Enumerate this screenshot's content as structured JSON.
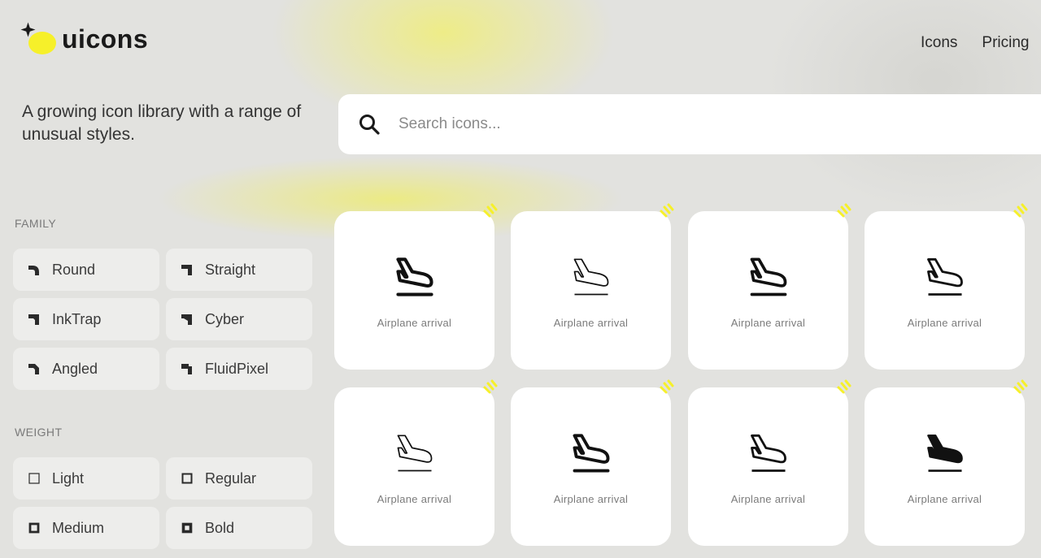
{
  "brand": {
    "name": "uicons",
    "accent": "#f6f02a"
  },
  "nav": {
    "items": [
      "Icons",
      "Pricing"
    ]
  },
  "tagline": "A growing icon library with a range of unusual styles.",
  "search": {
    "placeholder": "Search icons...",
    "value": ""
  },
  "family": {
    "label": "FAMILY",
    "items": [
      {
        "label": "Round",
        "icon": "corner-round-icon"
      },
      {
        "label": "Straight",
        "icon": "corner-straight-icon"
      },
      {
        "label": "InkTrap",
        "icon": "corner-inktrap-icon"
      },
      {
        "label": "Cyber",
        "icon": "corner-cyber-icon"
      },
      {
        "label": "Angled",
        "icon": "corner-angled-icon"
      },
      {
        "label": "FluidPixel",
        "icon": "corner-fluidpixel-icon"
      }
    ]
  },
  "weight": {
    "label": "WEIGHT",
    "items": [
      {
        "label": "Light",
        "icon": "square-light-icon"
      },
      {
        "label": "Regular",
        "icon": "square-regular-icon"
      },
      {
        "label": "Medium",
        "icon": "square-medium-icon"
      },
      {
        "label": "Bold",
        "icon": "square-bold-icon"
      }
    ]
  },
  "results": [
    {
      "label": "Airplane arrival",
      "icon": "airplane-arrival-icon"
    },
    {
      "label": "Airplane arrival",
      "icon": "airplane-arrival-icon"
    },
    {
      "label": "Airplane arrival",
      "icon": "airplane-arrival-icon"
    },
    {
      "label": "Airplane arrival",
      "icon": "airplane-arrival-icon"
    },
    {
      "label": "Airplane arrival",
      "icon": "airplane-arrival-icon"
    },
    {
      "label": "Airplane arrival",
      "icon": "airplane-arrival-icon"
    },
    {
      "label": "Airplane arrival",
      "icon": "airplane-arrival-icon"
    },
    {
      "label": "Airplane arrival",
      "icon": "airplane-arrival-icon"
    }
  ]
}
